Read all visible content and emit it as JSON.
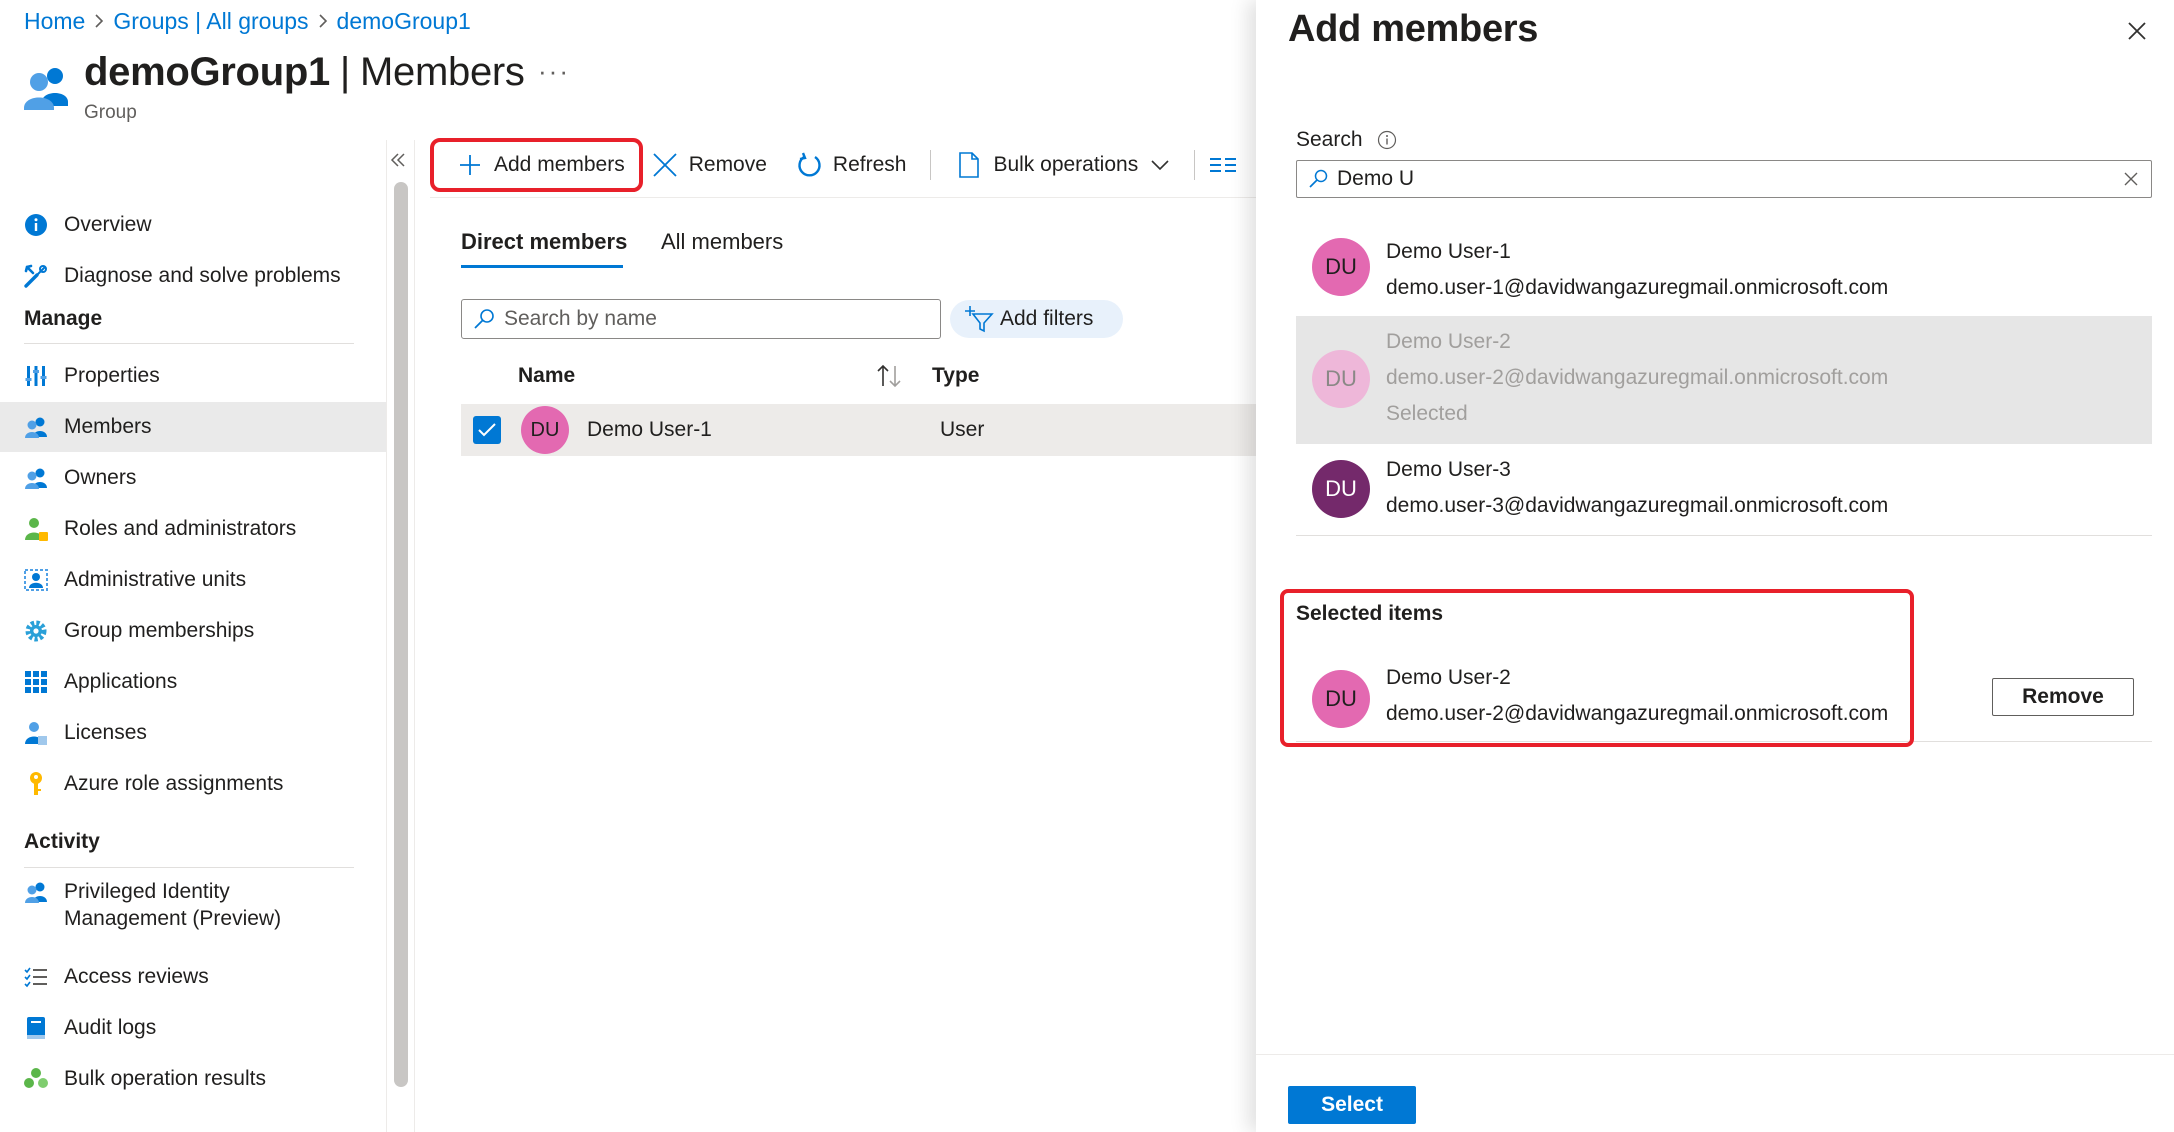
{
  "breadcrumb": {
    "items": [
      "Home",
      "Groups | All groups",
      "demoGroup1"
    ]
  },
  "header": {
    "title_strong": "demoGroup1",
    "title_rest": "Members",
    "separator": "|",
    "subtitle": "Group",
    "more": "···"
  },
  "sidebar": {
    "collapse": "«",
    "top_items": [
      {
        "label": "Overview",
        "icon": "info-icon"
      },
      {
        "label": "Diagnose and solve problems",
        "icon": "wrench-icon"
      }
    ],
    "sections": [
      {
        "title": "Manage",
        "items": [
          {
            "label": "Properties",
            "icon": "properties-icon"
          },
          {
            "label": "Members",
            "icon": "members-icon",
            "active": true
          },
          {
            "label": "Owners",
            "icon": "owners-icon"
          },
          {
            "label": "Roles and administrators",
            "icon": "roles-icon"
          },
          {
            "label": "Administrative units",
            "icon": "admin-units-icon"
          },
          {
            "label": "Group memberships",
            "icon": "gear-icon"
          },
          {
            "label": "Applications",
            "icon": "apps-grid-icon"
          },
          {
            "label": "Licenses",
            "icon": "licenses-icon"
          },
          {
            "label": "Azure role assignments",
            "icon": "key-icon"
          }
        ]
      },
      {
        "title": "Activity",
        "items": [
          {
            "label": "Privileged Identity",
            "label2": "Management (Preview)",
            "icon": "pim-icon"
          },
          {
            "label": "Access reviews",
            "icon": "checklist-icon"
          },
          {
            "label": "Audit logs",
            "icon": "book-icon"
          },
          {
            "label": "Bulk operation results",
            "icon": "bulk-results-icon"
          }
        ]
      }
    ]
  },
  "toolbar": {
    "add_members": "Add members",
    "remove": "Remove",
    "refresh": "Refresh",
    "bulk_operations": "Bulk operations"
  },
  "tabs": {
    "direct": "Direct members",
    "all": "All members"
  },
  "member_search": {
    "placeholder": "Search by name"
  },
  "add_filters": "Add filters",
  "table": {
    "columns": {
      "name": "Name",
      "type": "Type"
    },
    "rows": [
      {
        "initials": "DU",
        "name": "Demo User-1",
        "type": "User",
        "checked": true
      }
    ]
  },
  "panel": {
    "title": "Add members",
    "search_label": "Search",
    "search_value": "Demo U",
    "results": [
      {
        "initials": "DU",
        "name": "Demo User-1",
        "email": "demo.user-1@davidwangazuregmail.onmicrosoft.com"
      },
      {
        "initials": "DU",
        "name": "Demo User-2",
        "email": "demo.user-2@davidwangazuregmail.onmicrosoft.com",
        "status": "Selected"
      },
      {
        "initials": "DU",
        "name": "Demo User-3",
        "email": "demo.user-3@davidwangazuregmail.onmicrosoft.com"
      }
    ],
    "selected_heading": "Selected items",
    "selected": [
      {
        "initials": "DU",
        "name": "Demo User-2",
        "email": "demo.user-2@davidwangazuregmail.onmicrosoft.com"
      }
    ],
    "remove_label": "Remove",
    "select_label": "Select"
  },
  "colors": {
    "accent": "#0078d4",
    "highlight_border": "#e8202a",
    "avatar_pink": "#e369b1",
    "avatar_purple": "#74296b"
  }
}
